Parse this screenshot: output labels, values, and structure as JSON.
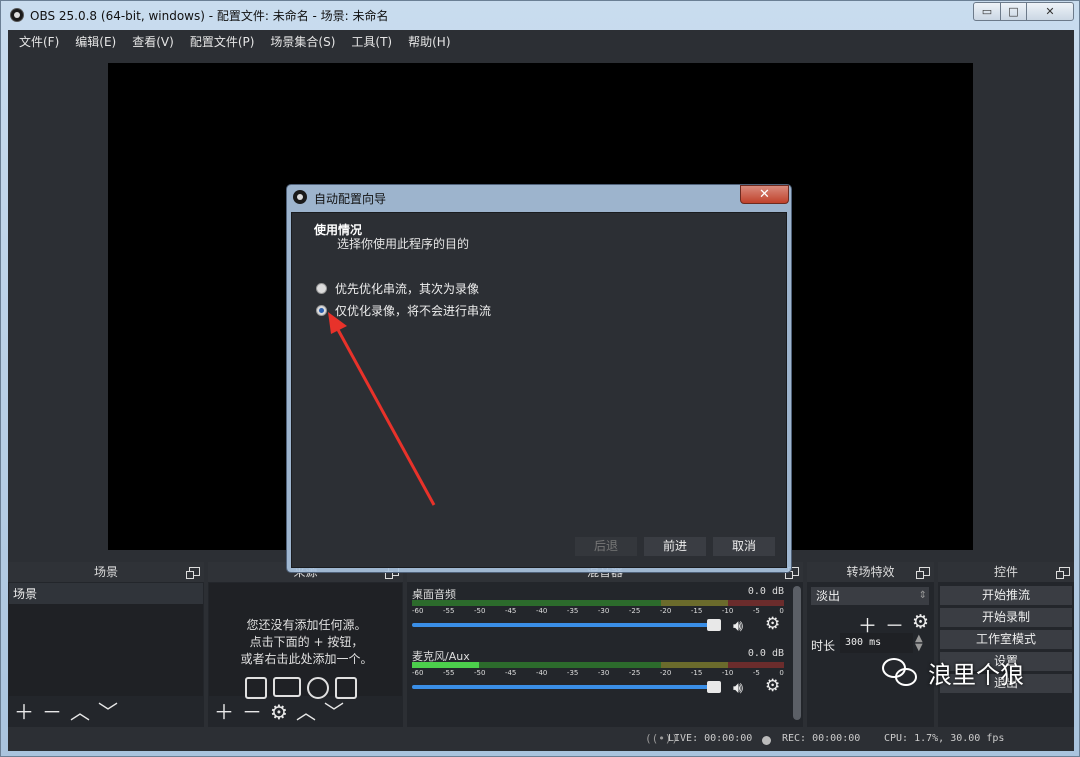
{
  "window": {
    "title": "OBS 25.0.8 (64-bit, windows) - 配置文件: 未命名 - 场景: 未命名"
  },
  "menu": [
    "文件(F)",
    "编辑(E)",
    "查看(V)",
    "配置文件(P)",
    "场景集合(S)",
    "工具(T)",
    "帮助(H)"
  ],
  "docks": {
    "scenes": {
      "title": "场景",
      "items": [
        "场景"
      ]
    },
    "sources": {
      "title": "来源",
      "hint": [
        "您还没有添加任何源。",
        "点击下面的 + 按钮，",
        "或者右击此处添加一个。"
      ]
    },
    "mixer": {
      "title": "混音器",
      "ticks": [
        "-60",
        "-55",
        "-50",
        "-45",
        "-40",
        "-35",
        "-30",
        "-25",
        "-20",
        "-15",
        "-10",
        "-5",
        "0"
      ],
      "channels": [
        {
          "name": "桌面音频",
          "db": "0.0 dB",
          "level": 0.0
        },
        {
          "name": "麦克风/Aux",
          "db": "0.0 dB",
          "level": 0.18
        }
      ]
    },
    "transitions": {
      "title": "转场特效",
      "selected": "淡出",
      "duration_label": "时长",
      "duration": "300 ms"
    },
    "controls": {
      "title": "控件",
      "buttons": [
        "开始推流",
        "开始录制",
        "工作室模式",
        "设置",
        "退出"
      ]
    }
  },
  "status": {
    "live": "LIVE: 00:00:00",
    "rec": "REC: 00:00:00",
    "cpu": "CPU: 1.7%, 30.00 fps"
  },
  "watermark": "浪里个狼",
  "dialog": {
    "title": "自动配置向导",
    "heading": "使用情况",
    "subheading": "选择你使用此程序的目的",
    "options": [
      {
        "label": "优先优化串流，其次为录像",
        "checked": false
      },
      {
        "label": "仅优化录像，将不会进行串流",
        "checked": true
      }
    ],
    "buttons": {
      "back": "后退",
      "next": "前进",
      "cancel": "取消"
    }
  },
  "colors": {
    "accent": "#3a8ee6",
    "arrow": "#e8322a",
    "panel": "#2c2f34"
  }
}
